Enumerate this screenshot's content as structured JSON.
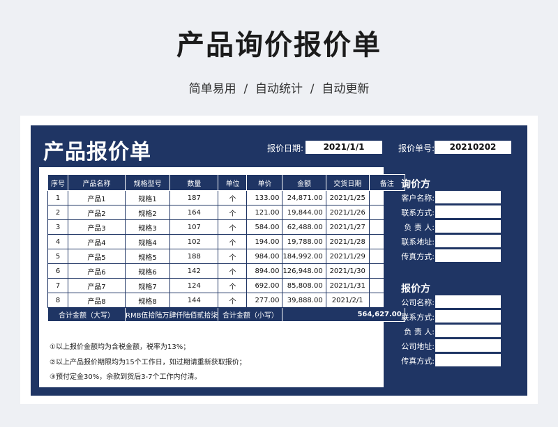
{
  "page": {
    "title": "产品询价报价单",
    "subtitle": "简单易用  /  自动统计  /  自动更新"
  },
  "sheet": {
    "title": "产品报价单",
    "date_label": "报价日期:",
    "date_value": "2021/1/1",
    "number_label": "报价单号:",
    "number_value": "20210202"
  },
  "table": {
    "headers": [
      "序号",
      "产品名称",
      "规格型号",
      "数量",
      "单位",
      "单价",
      "金额",
      "交货日期",
      "备注"
    ],
    "rows": [
      [
        "1",
        "产品1",
        "规格1",
        "187",
        "个",
        "133.00",
        "24,871.00",
        "2021/1/25",
        ""
      ],
      [
        "2",
        "产品2",
        "规格2",
        "164",
        "个",
        "121.00",
        "19,844.00",
        "2021/1/26",
        ""
      ],
      [
        "3",
        "产品3",
        "规格3",
        "107",
        "个",
        "584.00",
        "62,488.00",
        "2021/1/27",
        ""
      ],
      [
        "4",
        "产品4",
        "规格4",
        "102",
        "个",
        "194.00",
        "19,788.00",
        "2021/1/28",
        ""
      ],
      [
        "5",
        "产品5",
        "规格5",
        "188",
        "个",
        "984.00",
        "184,992.00",
        "2021/1/29",
        ""
      ],
      [
        "6",
        "产品6",
        "规格6",
        "142",
        "个",
        "894.00",
        "126,948.00",
        "2021/1/30",
        ""
      ],
      [
        "7",
        "产品7",
        "规格7",
        "124",
        "个",
        "692.00",
        "85,808.00",
        "2021/1/31",
        ""
      ],
      [
        "8",
        "产品8",
        "规格8",
        "144",
        "个",
        "277.00",
        "39,888.00",
        "2021/2/1",
        ""
      ]
    ],
    "total_upper_label": "合计金额（大写）",
    "total_upper_value": "RMB伍拾陆万肆仟陆佰贰拾柒",
    "total_lower_label": "合计金额（小写）",
    "total_lower_value": "564,627.00"
  },
  "notes": [
    "①以上报价金额均为含税金额，税率为13%；",
    "②以上产品报价期限均为15个工作日，如过期请重新获取报价；",
    "③预付定金30%，余款到货后3-7个工作内付清。"
  ],
  "inquirer": {
    "title": "询价方",
    "fields": [
      "客户名称:",
      "联系方式:",
      "负 责 人:",
      "联系地址:",
      "传真方式:"
    ]
  },
  "quoter": {
    "title": "报价方",
    "fields": [
      "公司名称:",
      "联系方式:",
      "负 责 人:",
      "公司地址:",
      "传真方式:"
    ]
  },
  "colors": {
    "navy": "#1f3564",
    "background": "#eef0f4"
  }
}
